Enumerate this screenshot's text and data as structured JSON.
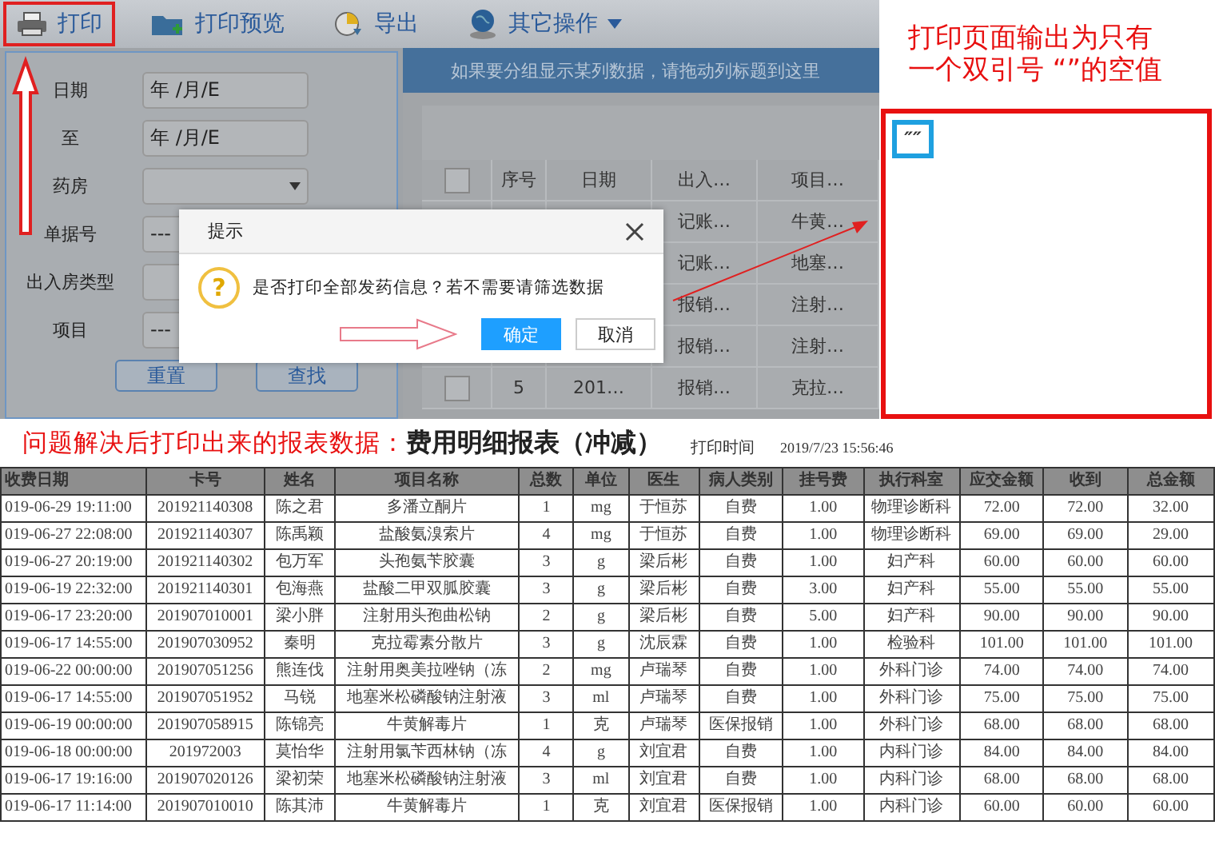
{
  "toolbar": {
    "buttons": [
      {
        "label": "打印",
        "highlighted": true,
        "dropdown": false
      },
      {
        "label": "打印预览",
        "highlighted": false,
        "dropdown": false
      },
      {
        "label": "导出",
        "highlighted": false,
        "dropdown": false
      },
      {
        "label": "其它操作",
        "highlighted": false,
        "dropdown": true
      }
    ]
  },
  "filter_form": {
    "fields": [
      {
        "label": "日期",
        "kind": "date",
        "value": "年 /月/E"
      },
      {
        "label": "至",
        "kind": "date",
        "value": "年 /月/E"
      },
      {
        "label": "药房",
        "kind": "select"
      },
      {
        "label": "单据号",
        "kind": "text",
        "value": "---"
      },
      {
        "label": "出入房类型",
        "kind": "text"
      },
      {
        "label": "项目",
        "kind": "text",
        "value": "---"
      }
    ],
    "buttons": [
      "重置",
      "查找"
    ]
  },
  "grid": {
    "group_hint": "如果要分组显示某列数据，请拖动列标题到这里",
    "columns": [
      "序号",
      "日期",
      "出入…",
      "项目…"
    ],
    "header_checked": false,
    "rows": [
      {
        "in_out": "记账…",
        "item": "牛黄…"
      },
      {
        "in_out": "记账…",
        "item": "地塞…"
      },
      {
        "in_out": "报销…",
        "item": "注射…"
      },
      {
        "in_out": "报销…",
        "item": "注射…"
      },
      {
        "checked": false,
        "seq": "5",
        "date": "201…",
        "in_out": "报销…",
        "item": "克拉…"
      }
    ]
  },
  "dialog": {
    "title": "提示",
    "icon_glyph": "?",
    "message": "是否打印全部发药信息？若不需要请筛选数据",
    "buttons": [
      {
        "label": "确定",
        "primary": true
      },
      {
        "label": "取消",
        "primary": false
      }
    ]
  },
  "annotation": {
    "note": "打印页面输出为只有一个双引号 “”的空值",
    "print_output": "″″"
  },
  "report": {
    "caption": "问题解决后打印出来的报表数据：",
    "title": "费用明细报表（冲减）",
    "print_time_label": "打印时间",
    "print_time": "2019/7/23 15:56:46",
    "columns": [
      "收费日期",
      "卡号",
      "姓名",
      "项目名称",
      "总数",
      "单位",
      "医生",
      "病人类别",
      "挂号费",
      "执行科室",
      "应交金额",
      "收到",
      "总金额"
    ],
    "rows": [
      [
        "019-06-29 19:11:00",
        "201921140308",
        "陈之君",
        "多潘立酮片",
        "1",
        "mg",
        "于恒苏",
        "自费",
        "1.00",
        "物理诊断科",
        "72.00",
        "72.00",
        "32.00"
      ],
      [
        "019-06-27 22:08:00",
        "201921140307",
        "陈禹颖",
        "盐酸氨溴索片",
        "4",
        "mg",
        "于恒苏",
        "自费",
        "1.00",
        "物理诊断科",
        "69.00",
        "69.00",
        "29.00"
      ],
      [
        "019-06-27 20:19:00",
        "201921140302",
        "包万军",
        "头孢氨苄胶囊",
        "3",
        "g",
        "梁后彬",
        "自费",
        "1.00",
        "妇产科",
        "60.00",
        "60.00",
        "60.00"
      ],
      [
        "019-06-19 22:32:00",
        "201921140301",
        "包海燕",
        "盐酸二甲双胍胶囊",
        "3",
        "g",
        "梁后彬",
        "自费",
        "3.00",
        "妇产科",
        "55.00",
        "55.00",
        "55.00"
      ],
      [
        "019-06-17 23:20:00",
        "201907010001",
        "梁小胖",
        "注射用头孢曲松钠",
        "2",
        "g",
        "梁后彬",
        "自费",
        "5.00",
        "妇产科",
        "90.00",
        "90.00",
        "90.00"
      ],
      [
        "019-06-17 14:55:00",
        "201907030952",
        "秦明",
        "克拉霉素分散片",
        "3",
        "g",
        "沈辰霖",
        "自费",
        "1.00",
        "检验科",
        "101.00",
        "101.00",
        "101.00"
      ],
      [
        "019-06-22 00:00:00",
        "201907051256",
        "熊连伐",
        "注射用奥美拉唑钠（冻",
        "2",
        "mg",
        "卢瑞琴",
        "自费",
        "1.00",
        "外科门诊",
        "74.00",
        "74.00",
        "74.00"
      ],
      [
        "019-06-17 14:55:00",
        "201907051952",
        "马锐",
        "地塞米松磷酸钠注射液",
        "3",
        "ml",
        "卢瑞琴",
        "自费",
        "1.00",
        "外科门诊",
        "75.00",
        "75.00",
        "75.00"
      ],
      [
        "019-06-19 00:00:00",
        "201907058915",
        "陈锦亮",
        "牛黄解毒片",
        "1",
        "克",
        "卢瑞琴",
        "医保报销",
        "1.00",
        "外科门诊",
        "68.00",
        "68.00",
        "68.00"
      ],
      [
        "019-06-18 00:00:00",
        "201972003",
        "莫怡华",
        "注射用氯苄西林钠（冻",
        "4",
        "g",
        "刘宜君",
        "自费",
        "1.00",
        "内科门诊",
        "84.00",
        "84.00",
        "84.00"
      ],
      [
        "019-06-17 19:16:00",
        "201907020126",
        "梁初荣",
        "地塞米松磷酸钠注射液",
        "3",
        "ml",
        "刘宜君",
        "自费",
        "1.00",
        "内科门诊",
        "68.00",
        "68.00",
        "68.00"
      ],
      [
        "019-06-17 11:14:00",
        "201907010010",
        "陈其沛",
        "牛黄解毒片",
        "1",
        "克",
        "刘宜君",
        "医保报销",
        "1.00",
        "内科门诊",
        "60.00",
        "60.00",
        "60.00"
      ]
    ]
  }
}
